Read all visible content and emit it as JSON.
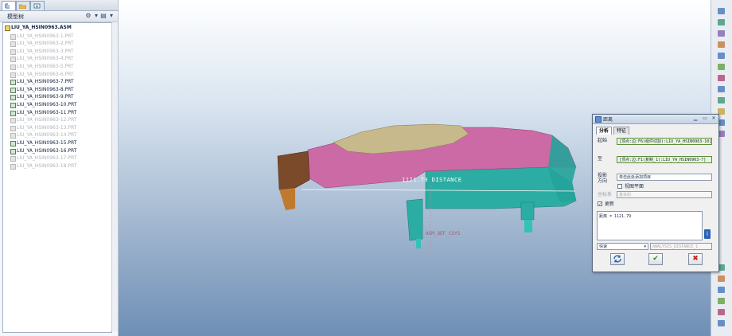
{
  "model_tree": {
    "header": "模型树",
    "tabs": [
      {
        "name": "model-tree-tab-icon"
      },
      {
        "name": "folder-browser-tab-icon"
      },
      {
        "name": "favorites-tab-icon"
      }
    ],
    "header_icons": [
      "settings-icon",
      "show-icon"
    ],
    "items": [
      {
        "label": "LIU_YA_HSIN0963.ASM",
        "state": "root"
      },
      {
        "label": "LIU_YA_HSIN0963-1.PRT",
        "state": "dim"
      },
      {
        "label": "LIU_YA_HSIN0963-2.PRT",
        "state": "dim"
      },
      {
        "label": "LIU_YA_HSIN0963-3.PRT",
        "state": "dim"
      },
      {
        "label": "LIU_YA_HSIN0963-4.PRT",
        "state": "dim"
      },
      {
        "label": "LIU_YA_HSIN0963-5.PRT",
        "state": "dim"
      },
      {
        "label": "LIU_YA_HSIN0963-6.PRT",
        "state": "dim"
      },
      {
        "label": "LIU_YA_HSIN0963-7.PRT",
        "state": "active"
      },
      {
        "label": "LIU_YA_HSIN0963-8.PRT",
        "state": "active"
      },
      {
        "label": "LIU_YA_HSIN0963-9.PRT",
        "state": "active"
      },
      {
        "label": "LIU_YA_HSIN0963-10.PRT",
        "state": "active"
      },
      {
        "label": "LIU_YA_HSIN0963-11.PRT",
        "state": "active"
      },
      {
        "label": "LIU_YA_HSIN0963-12.PRT",
        "state": "dim"
      },
      {
        "label": "LIU_YA_HSIN0963-13.PRT",
        "state": "dim"
      },
      {
        "label": "LIU_YA_HSIN0963-14.PRT",
        "state": "dim"
      },
      {
        "label": "LIU_YA_HSIN0963-15.PRT",
        "state": "active"
      },
      {
        "label": "LIU_YA_HSIN0963-16.PRT",
        "state": "active"
      },
      {
        "label": "LIU_YA_HSIN0963-17.PRT",
        "state": "dim"
      },
      {
        "label": "LIU_YA_HSIN0963-18.PRT",
        "state": "dim"
      }
    ]
  },
  "viewport": {
    "distance_label": "1121.79  DISTANCE",
    "csys_label": "ASM_DEF_CSYS"
  },
  "dialog": {
    "title": "距离",
    "tabs": [
      "分析",
      "特征"
    ],
    "from_label": "起始",
    "from_value": "[顶点:边:F6(组件切割):LIU_YA_HSIN0963-10]",
    "to_label": "至",
    "to_value": "[顶点:边:F1(复制_1):LIU_YA_HSIN0963-7]",
    "projection_label": "投影方向",
    "projection_value": "单击此处添加项目",
    "view_plane_label": "视图平面",
    "csys_label": "坐标系",
    "csys_value": "基本的",
    "update_label": "更新",
    "result_text": "距离 = 1121.79",
    "mode_value": "快速",
    "analysis_name": "ANALYSIS_DISTANCE_1"
  },
  "colors": {
    "body_pink": "#cc6aa6",
    "base_teal": "#2cada3",
    "roof_tan": "#c7b98c",
    "front_brown": "#7a4a2a",
    "dialog_border": "#5a6a80"
  }
}
